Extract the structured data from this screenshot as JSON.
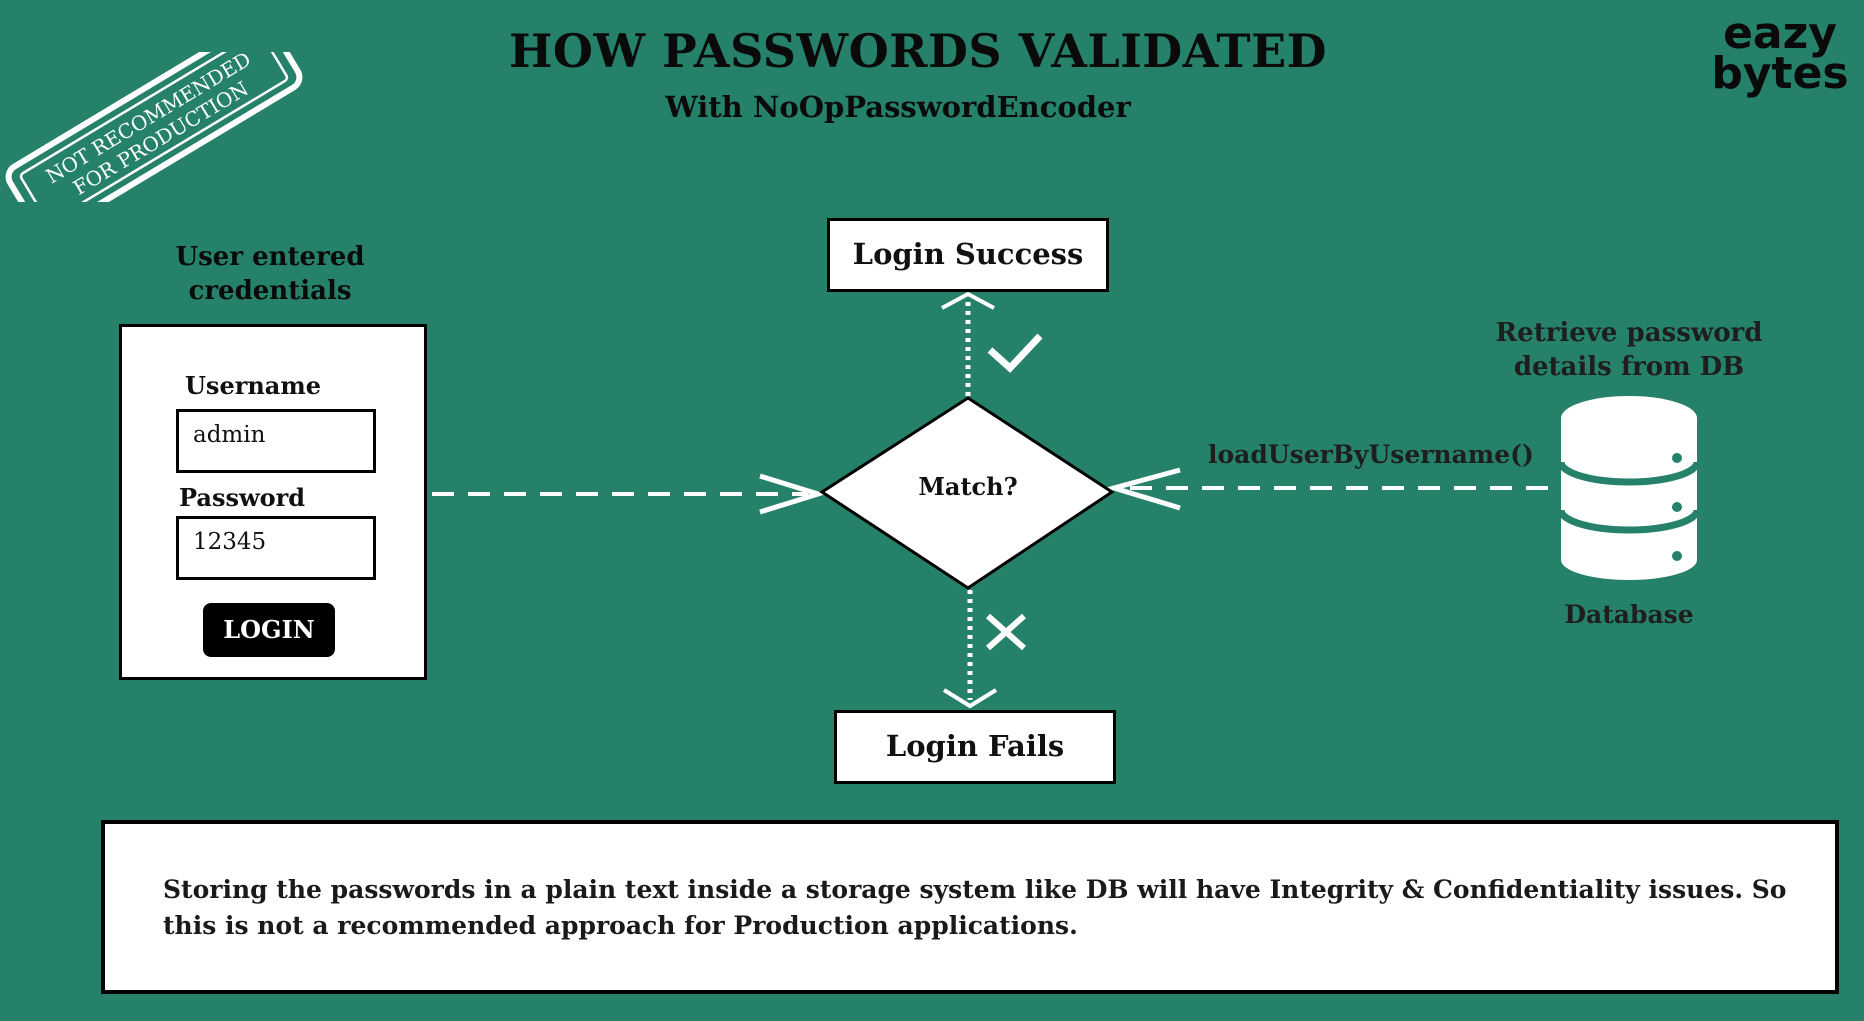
{
  "header": {
    "title": "HOW PASSWORDS VALIDATED",
    "subtitle": "With NoOpPasswordEncoder"
  },
  "brand": {
    "line1": "eazy",
    "line2": "bytes"
  },
  "stamp": {
    "line1": "NOT RECOMMENDED",
    "line2": "FOR PRODUCTION"
  },
  "credentials": {
    "heading_line1": "User entered",
    "heading_line2": "credentials",
    "username_label": "Username",
    "username_value": "admin",
    "password_label": "Password",
    "password_value": "12345",
    "login_button": "LOGIN"
  },
  "flow": {
    "decision": "Match?",
    "success": "Login Success",
    "failure": "Login Fails",
    "method": "loadUserByUsername()"
  },
  "database": {
    "heading_line1": "Retrieve password",
    "heading_line2": "details from DB",
    "caption": "Database",
    "icon": "database-icon"
  },
  "note": {
    "text": "Storing the passwords in a plain text inside a storage system like DB will have Integrity & Confidentiality issues. So this is not a recommended approach for Production applications."
  },
  "colors": {
    "background": "#26816a",
    "panel": "#ffffff",
    "ink": "#000000"
  }
}
